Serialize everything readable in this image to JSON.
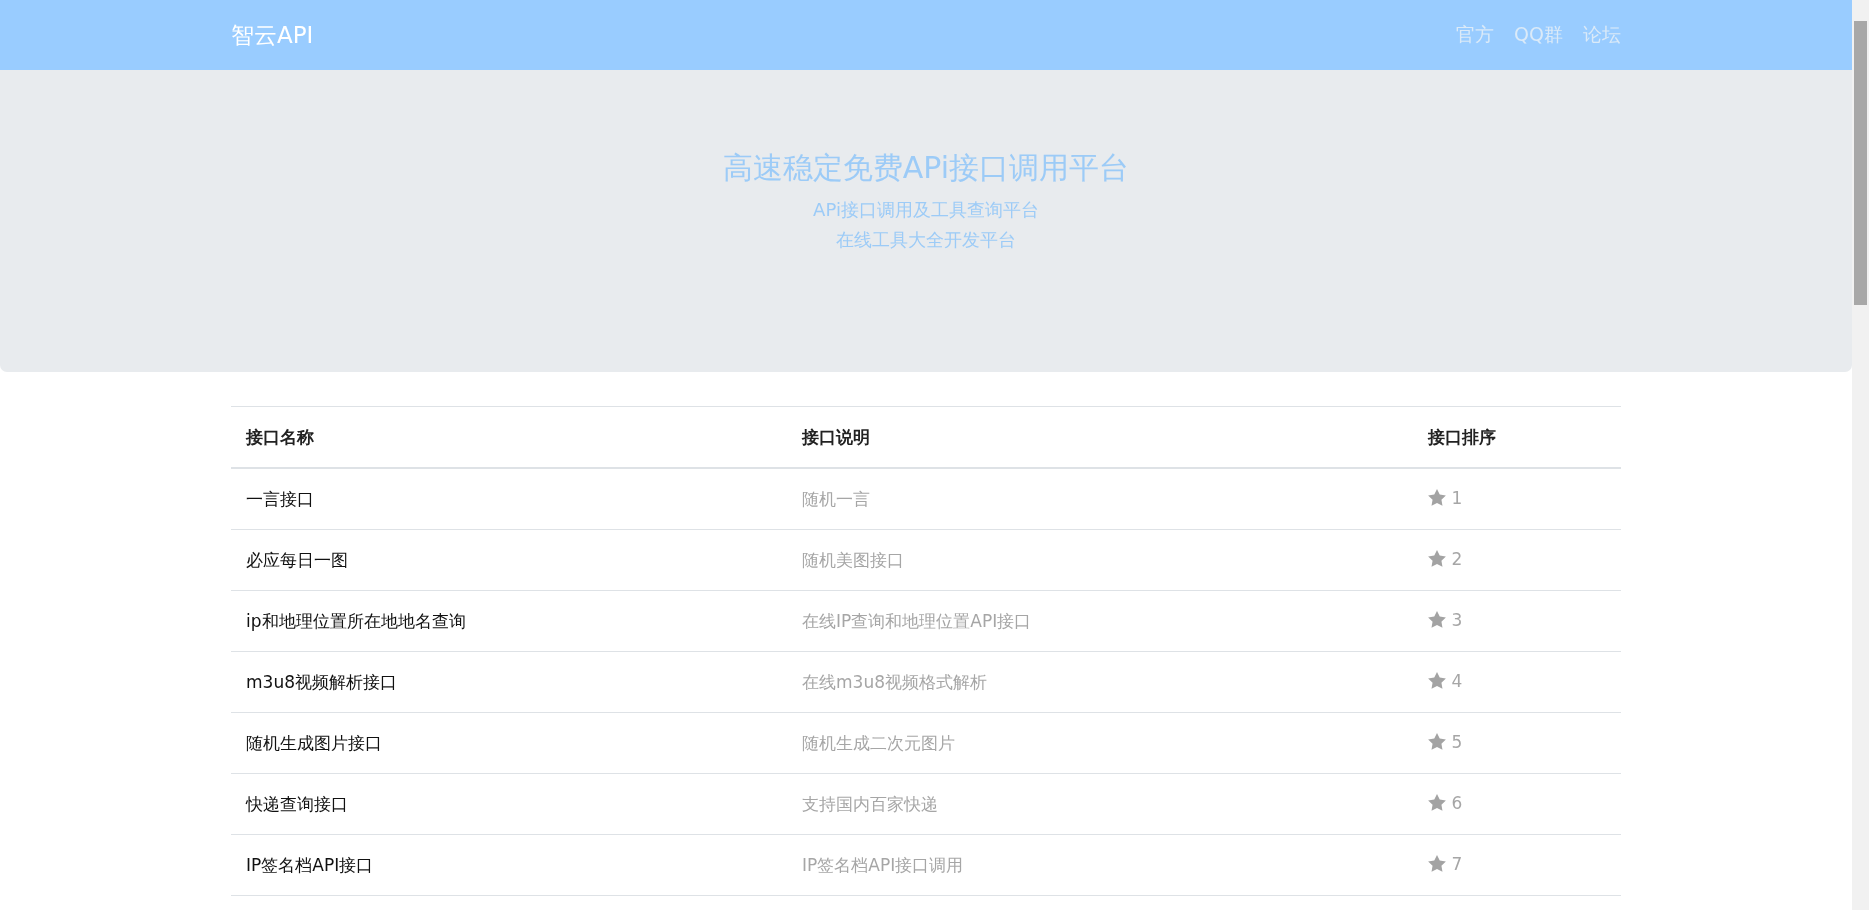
{
  "navbar": {
    "brand": "智云API",
    "links": [
      "官方",
      "QQ群",
      "论坛"
    ]
  },
  "hero": {
    "title": "高速稳定免费APi接口调用平台",
    "subtitles": [
      "APi接口调用及工具查询平台",
      "在线工具大全开发平台"
    ]
  },
  "table": {
    "columns": [
      "接口名称",
      "接口说明",
      "接口排序"
    ],
    "rows": [
      {
        "name": "一言接口",
        "description": "随机一言",
        "rank": "1"
      },
      {
        "name": "必应每日一图",
        "description": "随机美图接口",
        "rank": "2"
      },
      {
        "name": "ip和地理位置所在地地名查询",
        "description": "在线IP查询和地理位置API接口",
        "rank": "3"
      },
      {
        "name": "m3u8视频解析接口",
        "description": "在线m3u8视频格式解析",
        "rank": "4"
      },
      {
        "name": "随机生成图片接口",
        "description": "随机生成二次元图片",
        "rank": "5"
      },
      {
        "name": "快递查询接口",
        "description": "支持国内百家快递",
        "rank": "6"
      },
      {
        "name": "IP签名档API接口",
        "description": "IP签名档API接口调用",
        "rank": "7"
      }
    ]
  }
}
